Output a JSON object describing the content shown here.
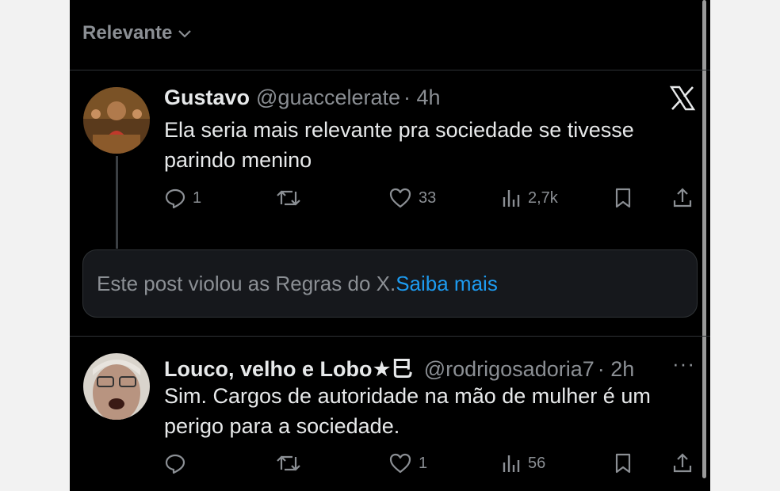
{
  "sort": {
    "label": "Relevante"
  },
  "posts": [
    {
      "name": "Gustavo",
      "handle": "@guaccelerate",
      "time": "· 4h",
      "text": "Ela seria mais relevante pra sociedade se tivesse parindo menino",
      "replies": "1",
      "reposts": "",
      "likes": "33",
      "views": "2,7k"
    },
    {
      "name": "Louco, velho e Lobo★⺒",
      "handle": "@rodrigosadoria7",
      "time": "· 2h",
      "text": "Sim. Cargos de autoridade na mão de mulher é um perigo para a sociedade.",
      "replies": "",
      "reposts": "",
      "likes": "1",
      "views": "56"
    }
  ],
  "notice": {
    "text": "Este post violou as Regras do X.",
    "link": "Saiba mais"
  },
  "colors": {
    "background": "#000000",
    "text": "#e7e9ea",
    "muted": "#8b8f94",
    "link": "#1d9bf0",
    "border": "#2f3336"
  },
  "icons": [
    "chevron-down-icon",
    "x-logo-icon",
    "reply-icon",
    "repost-icon",
    "like-icon",
    "views-icon",
    "bookmark-icon",
    "share-icon",
    "more-icon"
  ]
}
